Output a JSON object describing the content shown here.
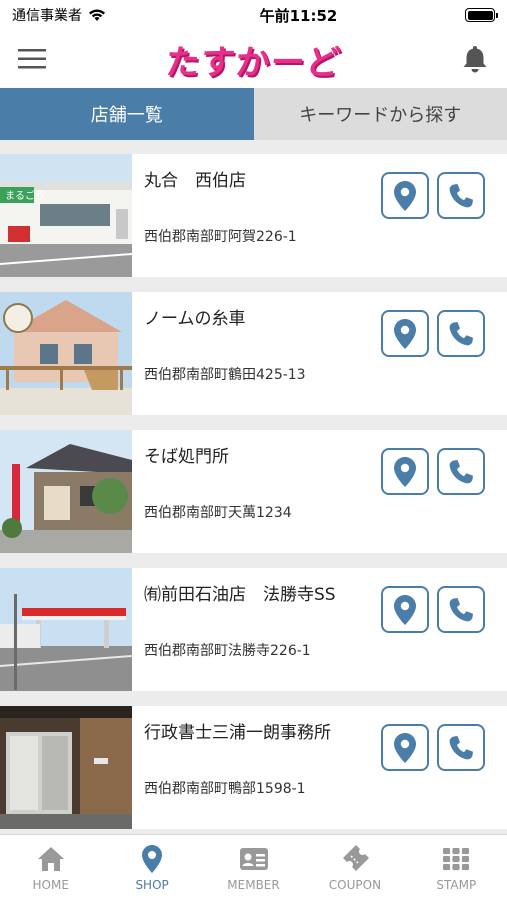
{
  "status": {
    "carrier": "通信事業者",
    "time": "午前11:52"
  },
  "header": {
    "logo_text": "たすかーど",
    "menu_icon": "hamburger-menu-icon",
    "bell_icon": "bell-icon"
  },
  "tabs": [
    {
      "label": "店舗一覧",
      "active": true
    },
    {
      "label": "キーワードから探す",
      "active": false
    }
  ],
  "shops": [
    {
      "name": "丸合　西伯店",
      "address": "西伯郡南部町阿賀226-1"
    },
    {
      "name": "ノームの糸車",
      "address": "西伯郡南部町鶴田425-13"
    },
    {
      "name": "そば処門所",
      "address": "西伯郡南部町天萬1234"
    },
    {
      "name": "㈲前田石油店　法勝寺SS",
      "address": "西伯郡南部町法勝寺226-1"
    },
    {
      "name": "行政書士三浦一朗事務所",
      "address": "西伯郡南部町鴨部1598-1"
    }
  ],
  "thumb_texts": {
    "shop1_sign": "まるごう"
  },
  "nav": [
    {
      "label": "HOME",
      "icon": "home-icon",
      "active": false
    },
    {
      "label": "SHOP",
      "icon": "map-pin-icon",
      "active": true
    },
    {
      "label": "MEMBER",
      "icon": "member-card-icon",
      "active": false
    },
    {
      "label": "COUPON",
      "icon": "ticket-icon",
      "active": false
    },
    {
      "label": "STAMP",
      "icon": "grid-icon",
      "active": false
    }
  ],
  "colors": {
    "accent": "#4a7da8",
    "logo": "#e8308a",
    "inactive_tab": "#dcdcdc",
    "nav_inactive": "#999999"
  }
}
